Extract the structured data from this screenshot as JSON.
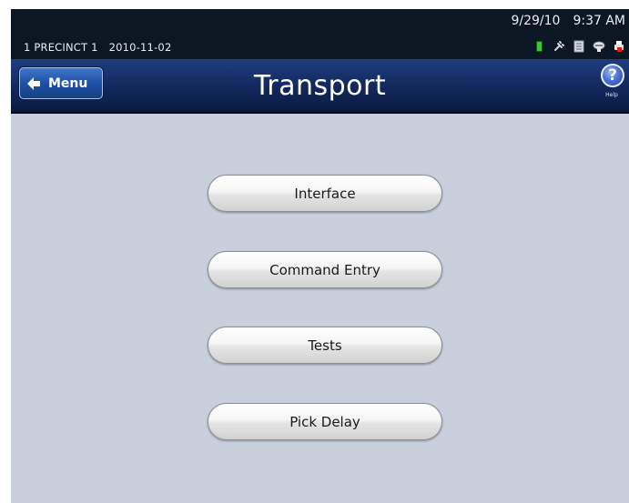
{
  "status_bar": {
    "precinct": "1 PRECINCT 1",
    "date": "2010-11-02",
    "clock_date": "9/29/10",
    "clock_time": "9:37 AM",
    "icons": [
      "battery-icon",
      "power-icon",
      "document-icon",
      "network-icon",
      "printer-icon"
    ]
  },
  "header": {
    "menu_label": "Menu",
    "title": "Transport",
    "help_label": "Help"
  },
  "main": {
    "buttons": [
      {
        "label": "Interface"
      },
      {
        "label": "Command Entry"
      },
      {
        "label": "Tests"
      },
      {
        "label": "Pick Delay"
      }
    ]
  },
  "colors": {
    "status_bar_bg": "#0d1623",
    "header_bg": "#1a3470",
    "content_bg": "#c9d0dc",
    "battery": "#38c935"
  }
}
